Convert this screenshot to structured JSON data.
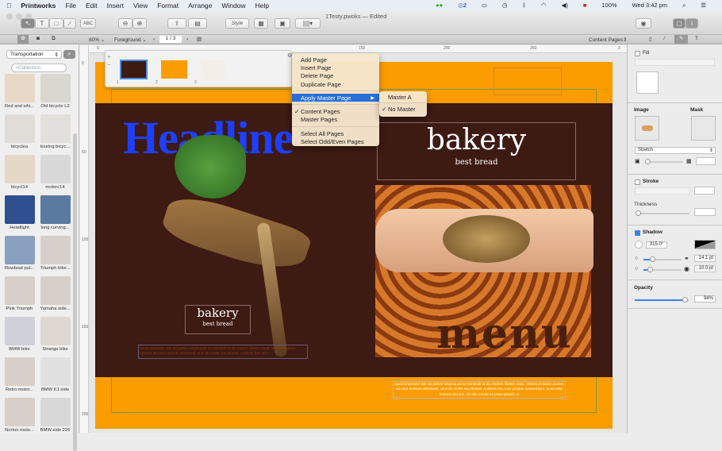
{
  "menubar": {
    "apple": "",
    "app": "Printworks",
    "items": [
      "File",
      "Edit",
      "Insert",
      "View",
      "Format",
      "Arrange",
      "Window",
      "Help"
    ],
    "status": {
      "badge": "2",
      "battery": "100%",
      "clock": "Wed 3:42 pm"
    }
  },
  "window": {
    "title": "1Testy.pwoks — Edited"
  },
  "toolbar": {
    "spell_label": "ABC",
    "style_label": "Style"
  },
  "subbar": {
    "zoom": "80%",
    "layer": "Foreground",
    "page": "1 / 3",
    "view_mode": "Content Pages"
  },
  "library": {
    "category": "Transportation",
    "search_placeholder": "Collection",
    "items": [
      "Red and whi...",
      "Old bicycle L2",
      "bicyclea",
      "touring bicyc...",
      "bicycl14",
      "motorc14",
      "Headlight",
      "long curving...",
      "Rowboat pul...",
      "Triumph bike...",
      "Pink Triumph",
      "Yamaha side...",
      "BMW bike",
      "Strange bike",
      "Retro motor...",
      "BMW K1 side",
      "Norton moto...",
      "BMW side 226"
    ]
  },
  "ruler": {
    "unit": "mm",
    "h_ticks": [
      "0",
      "150",
      "200",
      "250",
      "3"
    ],
    "v_ticks": [
      "0",
      "50",
      "100",
      "150",
      "200"
    ]
  },
  "page_strip": {
    "pages": [
      "1",
      "2",
      "3"
    ]
  },
  "context_menu": {
    "group1": [
      "Add Page",
      "Insert Page",
      "Delete Page",
      "Duplicate Page"
    ],
    "apply_master": "Apply Master Page",
    "group3": [
      "Content Pages",
      "Master Pages"
    ],
    "checked": "Content Pages",
    "group4": [
      "Select All Pages",
      "Select Odd/Even Pages"
    ],
    "submenu": [
      "Master A",
      "No Master"
    ],
    "submenu_checked": "No Master"
  },
  "document": {
    "headline": "Headline",
    "bakery_title": "bakery",
    "bakery_sub": "best bread",
    "menu_text": "menu",
    "small_bakery_title": "bakery",
    "small_bakery_sub": "best bread",
    "lorem_left": "Quod imperator iste ad partes longinquas se transtulit et diu morem ibidem traxit. Volens probare uxorem ad eam nuntium destinavit, ut ei de morte sua diceret. Audiens hoc uxor",
    "lorem_bottom": "Quod imperator iste ad partes longinquas se transtulit et diu morem ibidem traxit. Volens probare uxorem ad eam nuntium destinavit, ut ei de morte sua diceret. Audiens hoc uxor propter iuramentum, quod ante fecerat viro suo, de alto monte se praecipitavit, ut",
    "colors": {
      "orange": "#fb9c00",
      "brown": "#3d1a12",
      "headline_blue": "#1f3fff"
    }
  },
  "inspector": {
    "fill": "Fill",
    "image": "Image",
    "mask": "Mask",
    "scale_mode": "Stretch",
    "stroke": "Stroke",
    "thickness": "Thickness",
    "shadow": "Shadow",
    "shadow_checked": true,
    "angle": "315.0°",
    "offset": "14.1 pt",
    "blur": "10.0 pt",
    "opacity_label": "Opacity",
    "opacity": "94%",
    "opacity_value": 0.94
  }
}
